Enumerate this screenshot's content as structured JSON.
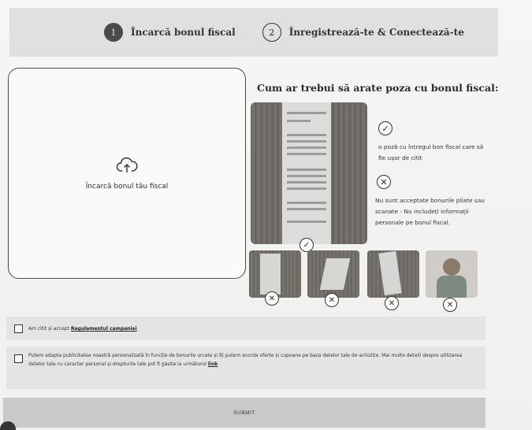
{
  "stepper": {
    "steps": [
      {
        "number": "1",
        "label": "Încarcă bonul fiscal",
        "active": true
      },
      {
        "number": "2",
        "label": "Înregistrează-te & Conectează-te",
        "active": false
      }
    ]
  },
  "upload": {
    "label": "Încarcă bonul tău fiscal",
    "icon": "cloud-upload-icon"
  },
  "guide": {
    "title": "Cum ar trebui să arate poza cu bonul fiscal:",
    "good_rule": "o poză cu întregul bon fiscal care să fie ușor de citit",
    "bad_rule": "Nu sunt acceptate bonurile pliate sau scanate - Nu includeți informații personale pe bonul fiscal."
  },
  "consent": {
    "terms_prefix": "Am citit și accept ",
    "terms_link": "Regulamentul campaniei",
    "marketing_text": "Putem adapta publicitatea noastră personalizată în funcție de bonurile urcate și îți putem acorda oferte și cupoane pe baza datelor tale de achiziție. Mai multe detalii despre utilizarea datelor tale cu caracter personal și drepturile tale pot fi găsite la următorul ",
    "marketing_link": "link"
  },
  "submit_label": "SUBMIT"
}
